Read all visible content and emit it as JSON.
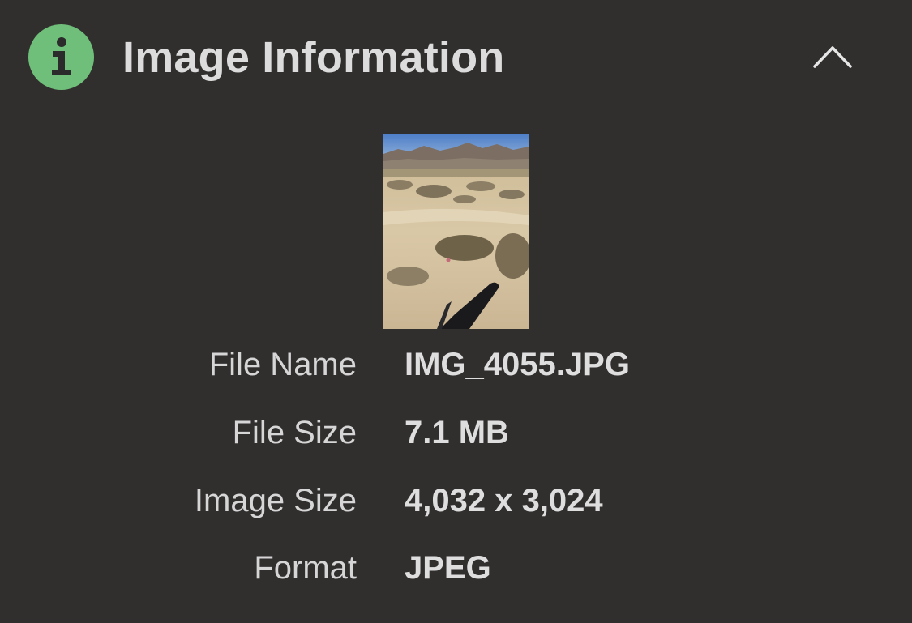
{
  "header": {
    "title": "Image Information",
    "icon": "info-icon",
    "icon_color": "#6fbf7a",
    "collapse_icon": "chevron-up-icon"
  },
  "preview": {
    "description_icon": "image-thumbnail"
  },
  "details": [
    {
      "label": "File Name",
      "value": "IMG_4055.JPG"
    },
    {
      "label": "File Size",
      "value": "7.1 MB"
    },
    {
      "label": "Image Size",
      "value": "4,032 x 3,024"
    },
    {
      "label": "Format",
      "value": "JPEG"
    }
  ],
  "colors": {
    "background": "#312f2e",
    "text": "#dcdcdc",
    "accent_green": "#6fbf7a"
  }
}
